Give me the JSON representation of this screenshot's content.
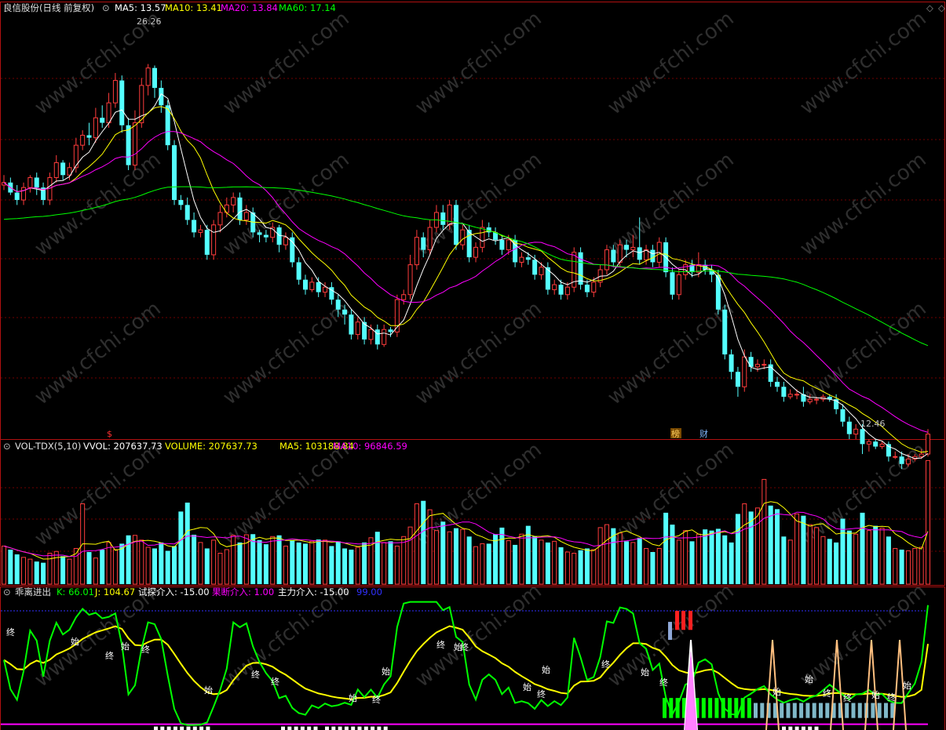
{
  "colors": {
    "frame": "#b01010",
    "grid": "#700000",
    "up": "#ff3c3c",
    "down": "#54ffff",
    "ma5": "#ffffff",
    "ma10": "#ffff00",
    "ma20": "#ff00ff",
    "ma60": "#00ff00",
    "kdjK": "#00ff00",
    "kdjJ": "#ffff00",
    "white": "#ffffff",
    "blue": "#3030ff"
  },
  "header": {
    "price_title": "良信股份(日线 前复权)",
    "ma5": "MA5: 13.57",
    "ma10": "MA10: 13.41",
    "ma20": "MA20: 13.84",
    "ma60": "MA60: 17.14",
    "vol_title": "VOL-TDX(5,10)",
    "vol_wvol": "VVOL: 207637.73",
    "vol_volume": "VOLUME: 207637.73",
    "vol_ma5": "MA5: 103188.84",
    "vol_ma10": "MA10: 96846.59",
    "ind_title": "乖离进出",
    "ind_k": "K: 66.01",
    "ind_j": "J: 104.67",
    "ind_shitan": "试探介入: -15.00",
    "ind_guoduan": "果断介入: 1.00",
    "ind_zhuli": "主力介入: -15.00",
    "ind_blue": "99.00"
  },
  "annotations": {
    "high_label": "26.26",
    "low_label": "12.46",
    "marker_s": "$",
    "marker_bang": "榜",
    "marker_cai": "财",
    "shi": "始",
    "zhong": "终"
  },
  "chart_data": [
    {
      "type": "candlestick",
      "title": "良信股份(日线 前复权)",
      "ylim": [
        11.2,
        28.2
      ],
      "candles": [
        [
          21.4,
          21.5,
          21.8,
          21.2
        ],
        [
          21.5,
          21.1,
          21.7,
          21.0
        ],
        [
          21.1,
          20.8,
          21.4,
          20.6
        ],
        [
          20.8,
          21.3,
          21.5,
          20.6
        ],
        [
          21.3,
          21.7,
          21.8,
          21.1
        ],
        [
          21.7,
          21.3,
          21.9,
          21.0
        ],
        [
          21.3,
          20.8,
          21.5,
          20.6
        ],
        [
          20.8,
          21.7,
          21.9,
          20.6
        ],
        [
          21.7,
          22.3,
          22.6,
          21.5
        ],
        [
          22.3,
          21.8,
          22.4,
          21.6
        ],
        [
          21.8,
          22.1,
          22.3,
          21.6
        ],
        [
          22.1,
          23.0,
          23.3,
          21.9
        ],
        [
          23.0,
          23.4,
          23.6,
          22.8
        ],
        [
          23.4,
          23.3,
          23.9,
          23.0
        ],
        [
          23.3,
          24.1,
          24.5,
          23.1
        ],
        [
          24.1,
          23.9,
          24.6,
          23.7
        ],
        [
          23.9,
          24.7,
          25.1,
          23.7
        ],
        [
          24.7,
          25.6,
          25.9,
          24.5
        ],
        [
          25.6,
          23.8,
          25.8,
          23.5
        ],
        [
          23.8,
          22.2,
          24.1,
          22.0
        ],
        [
          22.2,
          23.9,
          24.4,
          22.0
        ],
        [
          23.9,
          25.4,
          25.7,
          23.7
        ],
        [
          25.4,
          26.1,
          26.26,
          25.0
        ],
        [
          26.1,
          25.3,
          26.2,
          24.9
        ],
        [
          25.3,
          24.6,
          25.6,
          24.3
        ],
        [
          24.6,
          23.0,
          24.8,
          22.8
        ],
        [
          23.0,
          20.8,
          23.2,
          20.6
        ],
        [
          20.8,
          20.6,
          21.0,
          20.4
        ],
        [
          20.6,
          20.0,
          20.9,
          19.8
        ],
        [
          20.0,
          19.5,
          20.3,
          19.3
        ],
        [
          19.5,
          19.6,
          19.8,
          19.3
        ],
        [
          19.6,
          18.6,
          19.8,
          18.4
        ],
        [
          18.6,
          19.8,
          20.0,
          18.4
        ],
        [
          19.8,
          20.3,
          20.6,
          19.5
        ],
        [
          20.3,
          20.6,
          20.9,
          20.1
        ],
        [
          20.6,
          20.9,
          21.1,
          20.3
        ],
        [
          20.9,
          20.0,
          21.1,
          19.8
        ],
        [
          20.0,
          20.3,
          20.6,
          19.8
        ],
        [
          20.3,
          19.5,
          20.5,
          19.3
        ],
        [
          19.5,
          19.4,
          19.6,
          19.1
        ],
        [
          19.4,
          19.3,
          19.6,
          19.1
        ],
        [
          19.3,
          19.7,
          19.9,
          19.1
        ],
        [
          19.7,
          19.0,
          19.8,
          18.7
        ],
        [
          19.0,
          19.3,
          19.5,
          18.8
        ],
        [
          19.3,
          18.3,
          19.5,
          18.1
        ],
        [
          18.3,
          17.6,
          18.5,
          17.4
        ],
        [
          17.6,
          17.2,
          17.8,
          17.0
        ],
        [
          17.2,
          17.5,
          17.7,
          17.1
        ],
        [
          17.5,
          17.1,
          17.7,
          16.9
        ],
        [
          17.1,
          17.3,
          17.5,
          16.9
        ],
        [
          17.3,
          16.8,
          17.5,
          16.6
        ],
        [
          16.8,
          16.4,
          17.0,
          16.1
        ],
        [
          16.4,
          16.2,
          16.6,
          15.8
        ],
        [
          16.2,
          15.4,
          16.4,
          15.2
        ],
        [
          15.4,
          15.9,
          16.1,
          15.2
        ],
        [
          15.9,
          15.2,
          16.1,
          15.0
        ],
        [
          15.2,
          15.6,
          15.8,
          15.0
        ],
        [
          15.6,
          15.0,
          15.8,
          14.8
        ],
        [
          15.0,
          15.6,
          15.8,
          14.9
        ],
        [
          15.6,
          15.5,
          15.7,
          15.3
        ],
        [
          15.5,
          16.8,
          17.0,
          15.3
        ],
        [
          16.8,
          17.0,
          17.2,
          16.6
        ],
        [
          17.0,
          18.2,
          18.6,
          16.8
        ],
        [
          18.2,
          19.3,
          19.6,
          18.0
        ],
        [
          19.3,
          18.8,
          19.5,
          18.5
        ],
        [
          18.8,
          19.7,
          20.0,
          18.6
        ],
        [
          19.7,
          20.3,
          20.6,
          19.5
        ],
        [
          20.3,
          19.8,
          20.6,
          19.6
        ],
        [
          19.8,
          20.6,
          20.8,
          19.6
        ],
        [
          20.6,
          19.0,
          20.8,
          18.8
        ],
        [
          19.0,
          19.6,
          19.8,
          18.8
        ],
        [
          19.6,
          18.5,
          19.8,
          18.3
        ],
        [
          18.5,
          18.9,
          19.1,
          18.3
        ],
        [
          18.9,
          19.7,
          20.0,
          18.7
        ],
        [
          19.7,
          19.5,
          19.9,
          19.3
        ],
        [
          19.5,
          19.2,
          19.7,
          19.0
        ],
        [
          19.2,
          18.8,
          19.4,
          18.6
        ],
        [
          18.8,
          19.2,
          19.4,
          18.6
        ],
        [
          19.2,
          18.3,
          19.4,
          18.1
        ],
        [
          18.3,
          18.5,
          18.7,
          18.1
        ],
        [
          18.5,
          18.4,
          18.7,
          18.2
        ],
        [
          18.4,
          17.8,
          18.6,
          17.6
        ],
        [
          17.8,
          18.1,
          18.3,
          17.6
        ],
        [
          18.1,
          17.2,
          18.3,
          17.0
        ],
        [
          17.2,
          17.4,
          17.6,
          17.0
        ],
        [
          17.4,
          17.0,
          17.6,
          16.8
        ],
        [
          17.0,
          17.3,
          17.5,
          16.8
        ],
        [
          17.3,
          18.7,
          18.9,
          17.1
        ],
        [
          18.7,
          17.4,
          18.9,
          17.2
        ],
        [
          17.4,
          17.1,
          17.6,
          16.9
        ],
        [
          17.1,
          17.5,
          17.7,
          16.9
        ],
        [
          17.5,
          18.0,
          18.2,
          17.3
        ],
        [
          18.0,
          18.8,
          19.0,
          17.8
        ],
        [
          18.8,
          18.3,
          19.0,
          18.1
        ],
        [
          18.3,
          19.0,
          19.2,
          18.1
        ],
        [
          19.0,
          18.8,
          19.2,
          18.5
        ],
        [
          18.8,
          18.9,
          19.4,
          18.5
        ],
        [
          18.9,
          18.4,
          20.1,
          18.2
        ],
        [
          18.4,
          18.8,
          19.0,
          18.2
        ],
        [
          18.8,
          18.3,
          19.0,
          18.1
        ],
        [
          18.3,
          19.1,
          19.3,
          18.1
        ],
        [
          19.1,
          17.9,
          19.3,
          17.7
        ],
        [
          17.9,
          17.0,
          18.1,
          16.8
        ],
        [
          17.0,
          17.8,
          18.0,
          16.8
        ],
        [
          17.8,
          18.2,
          18.4,
          17.6
        ],
        [
          18.2,
          17.9,
          18.4,
          17.7
        ],
        [
          17.9,
          18.2,
          18.7,
          17.7
        ],
        [
          18.2,
          18.0,
          18.4,
          17.8
        ],
        [
          18.0,
          17.8,
          18.2,
          17.5
        ],
        [
          17.8,
          16.4,
          18.0,
          16.2
        ],
        [
          16.4,
          14.6,
          16.6,
          14.4
        ],
        [
          14.6,
          13.9,
          14.8,
          13.6
        ],
        [
          13.9,
          13.3,
          14.1,
          12.9
        ],
        [
          13.3,
          14.5,
          14.8,
          13.1
        ],
        [
          14.5,
          14.1,
          14.7,
          13.9
        ],
        [
          14.1,
          14.2,
          14.4,
          13.9
        ],
        [
          14.2,
          14.2,
          14.4,
          14.0
        ],
        [
          14.2,
          13.5,
          14.4,
          13.3
        ],
        [
          13.5,
          13.3,
          13.7,
          13.1
        ],
        [
          13.3,
          12.9,
          13.5,
          12.7
        ],
        [
          12.9,
          13.0,
          13.2,
          12.8
        ],
        [
          13.0,
          13.0,
          13.2,
          12.8
        ],
        [
          13.0,
          12.7,
          13.3,
          12.5
        ],
        [
          12.7,
          12.8,
          13.0,
          12.6
        ],
        [
          12.8,
          12.8,
          12.9,
          12.6
        ],
        [
          12.8,
          12.9,
          13.0,
          12.7
        ],
        [
          12.9,
          12.8,
          13.0,
          12.7
        ],
        [
          12.8,
          12.4,
          13.0,
          12.2
        ],
        [
          12.4,
          11.9,
          12.6,
          11.7
        ],
        [
          11.9,
          11.4,
          12.1,
          11.2
        ],
        [
          11.4,
          11.6,
          11.8,
          11.2
        ],
        [
          11.6,
          11.0,
          11.8,
          10.6
        ],
        [
          11.0,
          11.1,
          11.2,
          10.7
        ],
        [
          11.1,
          10.9,
          11.2,
          10.8
        ],
        [
          10.9,
          11.0,
          11.1,
          10.8
        ],
        [
          11.0,
          10.5,
          11.1,
          10.3
        ],
        [
          10.5,
          10.5,
          10.7,
          10.4
        ],
        [
          10.5,
          10.2,
          10.7,
          10.0
        ],
        [
          10.2,
          10.4,
          10.6,
          10.1
        ],
        [
          10.4,
          10.5,
          10.6,
          10.3
        ],
        [
          10.5,
          10.6,
          10.8,
          10.4
        ],
        [
          10.6,
          11.4,
          11.6,
          10.5
        ]
      ],
      "ma_series": [
        {
          "name": "MA5",
          "last": 13.57
        },
        {
          "name": "MA10",
          "last": 13.41
        },
        {
          "name": "MA20",
          "last": 13.84
        },
        {
          "name": "MA60",
          "last": 17.14
        }
      ],
      "annotations": [
        "26.26",
        "12.46"
      ]
    },
    {
      "type": "bar",
      "title": "VOL-TDX(5,10)",
      "ylim": [
        0,
        220000
      ],
      "volume_last": 207637.73,
      "ma5_last": 103188.84,
      "ma10_last": 96846.59,
      "values": [
        64000,
        58000,
        50000,
        45000,
        42000,
        38000,
        36000,
        52000,
        55000,
        47000,
        42000,
        60000,
        135000,
        54000,
        44000,
        58000,
        70000,
        58000,
        68000,
        82000,
        82000,
        74000,
        62000,
        60000,
        70000,
        56000,
        64000,
        122000,
        137000,
        83000,
        70000,
        60000,
        74000,
        52000,
        58000,
        82000,
        70000,
        83000,
        84000,
        74000,
        67000,
        80000,
        82000,
        64000,
        74000,
        70000,
        68000,
        72000,
        75000,
        74000,
        64000,
        72000,
        60000,
        58000,
        62000,
        70000,
        78000,
        88000,
        70000,
        72000,
        64000,
        80000,
        96000,
        135000,
        140000,
        125000,
        90000,
        105000,
        88000,
        94000,
        92000,
        80000,
        63000,
        68000,
        68000,
        84000,
        95000,
        73000,
        66000,
        84000,
        98000,
        80000,
        74000,
        70000,
        72000,
        62000,
        54000,
        52000,
        57000,
        60000,
        58000,
        95000,
        100000,
        94000,
        86000,
        72000,
        70000,
        78000,
        60000,
        54000,
        60000,
        120000,
        100000,
        74000,
        90000,
        72000,
        84000,
        92000,
        90000,
        93000,
        82000,
        70000,
        118000,
        135000,
        122000,
        128000,
        176000,
        132000,
        126000,
        80000,
        74000,
        118000,
        115000,
        100000,
        95000,
        80000,
        76000,
        70000,
        110000,
        90000,
        84000,
        120000,
        90000,
        98000,
        94000,
        80000,
        60000,
        58000,
        56000,
        60000,
        62000,
        207637
      ]
    },
    {
      "type": "line",
      "title": "乖离进出",
      "ylim": [
        -20,
        110
      ],
      "series": [
        {
          "name": "K",
          "last": 66.01
        },
        {
          "name": "J",
          "last": 104.67
        }
      ],
      "reference_lines": [
        -15.0,
        1.0,
        99.0
      ]
    }
  ]
}
